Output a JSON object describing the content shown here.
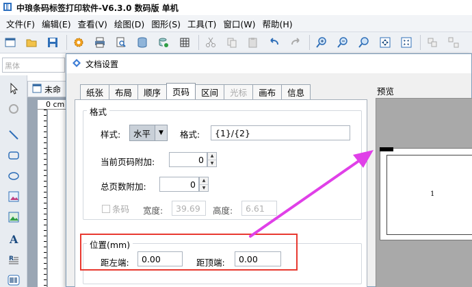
{
  "app": {
    "title": "中琅条码标签打印软件-V6.3.0 数码版 单机"
  },
  "menu": [
    "文件(F)",
    "编辑(E)",
    "查看(V)",
    "绘图(D)",
    "图形(S)",
    "工具(T)",
    "窗口(W)",
    "帮助(H)"
  ],
  "font_box": {
    "placeholder": "黑体"
  },
  "doc_tab": {
    "label": "未命"
  },
  "ruler": {
    "label": "0 cm"
  },
  "dialog": {
    "title": "文档设置",
    "tabs": [
      {
        "label": "纸张",
        "state": "normal"
      },
      {
        "label": "布局",
        "state": "normal"
      },
      {
        "label": "顺序",
        "state": "normal"
      },
      {
        "label": "页码",
        "state": "active"
      },
      {
        "label": "区间",
        "state": "normal"
      },
      {
        "label": "光标",
        "state": "disabled"
      },
      {
        "label": "画布",
        "state": "normal"
      },
      {
        "label": "信息",
        "state": "normal"
      }
    ],
    "format_group": {
      "title": "格式",
      "style_label": "样式:",
      "style_value": "水平",
      "format_label": "格式:",
      "format_value": "{1}/{2}",
      "current_page_label": "当前页码附加:",
      "current_page_value": "0",
      "total_pages_label": "总页数附加:",
      "total_pages_value": "0",
      "barcode_label": "条码",
      "width_label": "宽度:",
      "width_value": "39.69",
      "height_label": "高度:",
      "height_value": "6.61"
    },
    "position_group": {
      "title": "位置(mm)",
      "left_label": "距左端:",
      "left_value": "0.00",
      "top_label": "距顶端:",
      "top_value": "0.00"
    },
    "preview": {
      "label": "预览",
      "page_number": "1"
    }
  },
  "colors": {
    "highlight_box": "#e8382f",
    "arrow": "#e040e8",
    "dialog_border": "#7f9db9"
  }
}
